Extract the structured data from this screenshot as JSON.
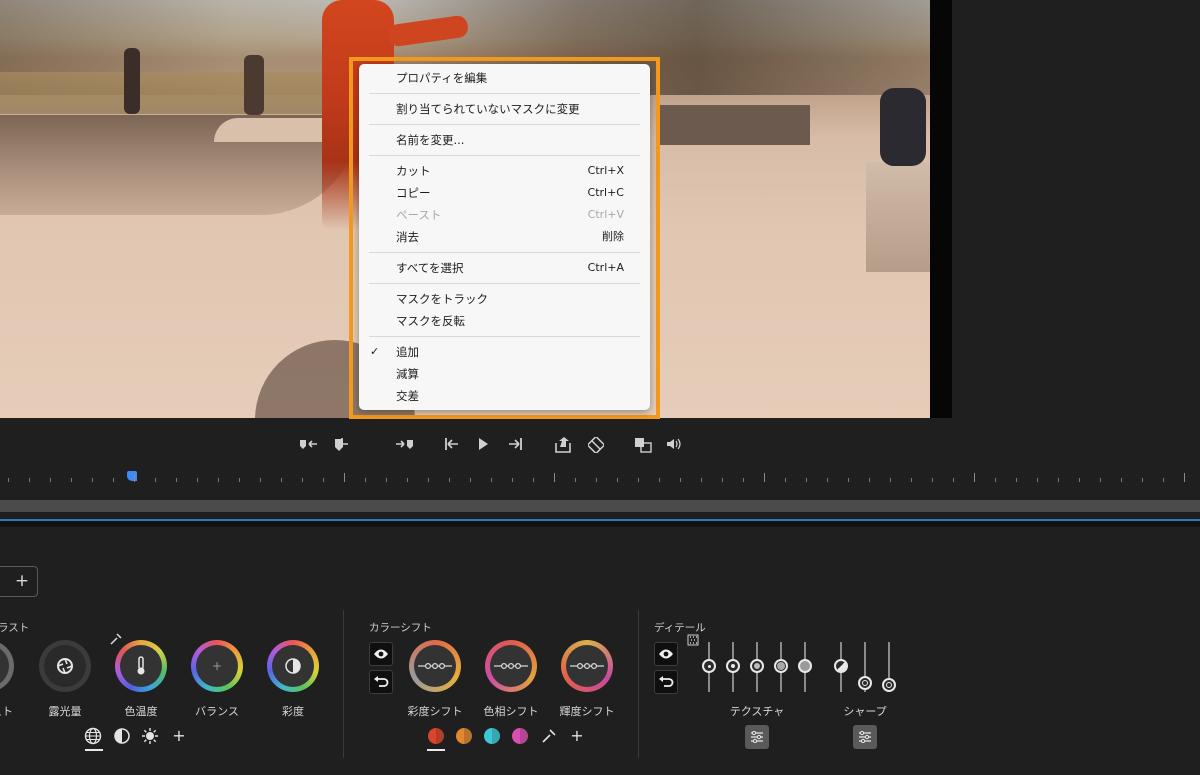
{
  "context_menu": {
    "items": [
      {
        "label": "プロパティを編集",
        "shortcut": "",
        "enabled": true,
        "checked": false
      },
      {
        "label": "割り当てられていないマスクに変更",
        "shortcut": "",
        "enabled": true,
        "checked": false
      },
      {
        "label": "名前を変更...",
        "shortcut": "",
        "enabled": true,
        "checked": false
      },
      {
        "label": "カット",
        "shortcut": "Ctrl+X",
        "enabled": true,
        "checked": false
      },
      {
        "label": "コピー",
        "shortcut": "Ctrl+C",
        "enabled": true,
        "checked": false
      },
      {
        "label": "ペースト",
        "shortcut": "Ctrl+V",
        "enabled": false,
        "checked": false
      },
      {
        "label": "消去",
        "shortcut": "削除",
        "enabled": true,
        "checked": false
      },
      {
        "label": "すべてを選択",
        "shortcut": "Ctrl+A",
        "enabled": true,
        "checked": false
      },
      {
        "label": "マスクをトラック",
        "shortcut": "",
        "enabled": true,
        "checked": false
      },
      {
        "label": "マスクを反転",
        "shortcut": "",
        "enabled": true,
        "checked": false
      },
      {
        "label": "追加",
        "shortcut": "",
        "enabled": true,
        "checked": true
      },
      {
        "label": "減算",
        "shortcut": "",
        "enabled": true,
        "checked": false
      },
      {
        "label": "交差",
        "shortcut": "",
        "enabled": true,
        "checked": false
      }
    ],
    "check_glyph": "✓"
  },
  "transport": {
    "icons": [
      "mark-in-icon",
      "mark-clip-icon",
      "mark-out-icon",
      "go-to-in-icon",
      "play-icon",
      "go-to-out-icon",
      "export-frame-icon",
      "loop-icon",
      "safe-margins-icon",
      "volume-icon"
    ]
  },
  "mask_bar": {
    "add_label": "+"
  },
  "sections": {
    "left": {
      "title": "ラスト",
      "dials": [
        {
          "label": "スト"
        },
        {
          "label": "露光量"
        },
        {
          "label": "色温度"
        },
        {
          "label": "バランス"
        },
        {
          "label": "彩度"
        }
      ],
      "add_label": "+"
    },
    "color_shift": {
      "title": "カラーシフト",
      "dials": [
        {
          "label": "彩度シフト"
        },
        {
          "label": "色相シフト"
        },
        {
          "label": "輝度シフト"
        }
      ],
      "swatch_colors": [
        "#d9452b",
        "#e2872e",
        "#3ec7d9",
        "#d94fb3"
      ],
      "add_label": "+"
    },
    "detail": {
      "title": "ディテール",
      "texture_label": "テクスチャ",
      "sharpen_label": "シャープ"
    }
  },
  "colors": {
    "accent_orange": "#f39a1e",
    "playhead_blue": "#3b8cf5"
  }
}
